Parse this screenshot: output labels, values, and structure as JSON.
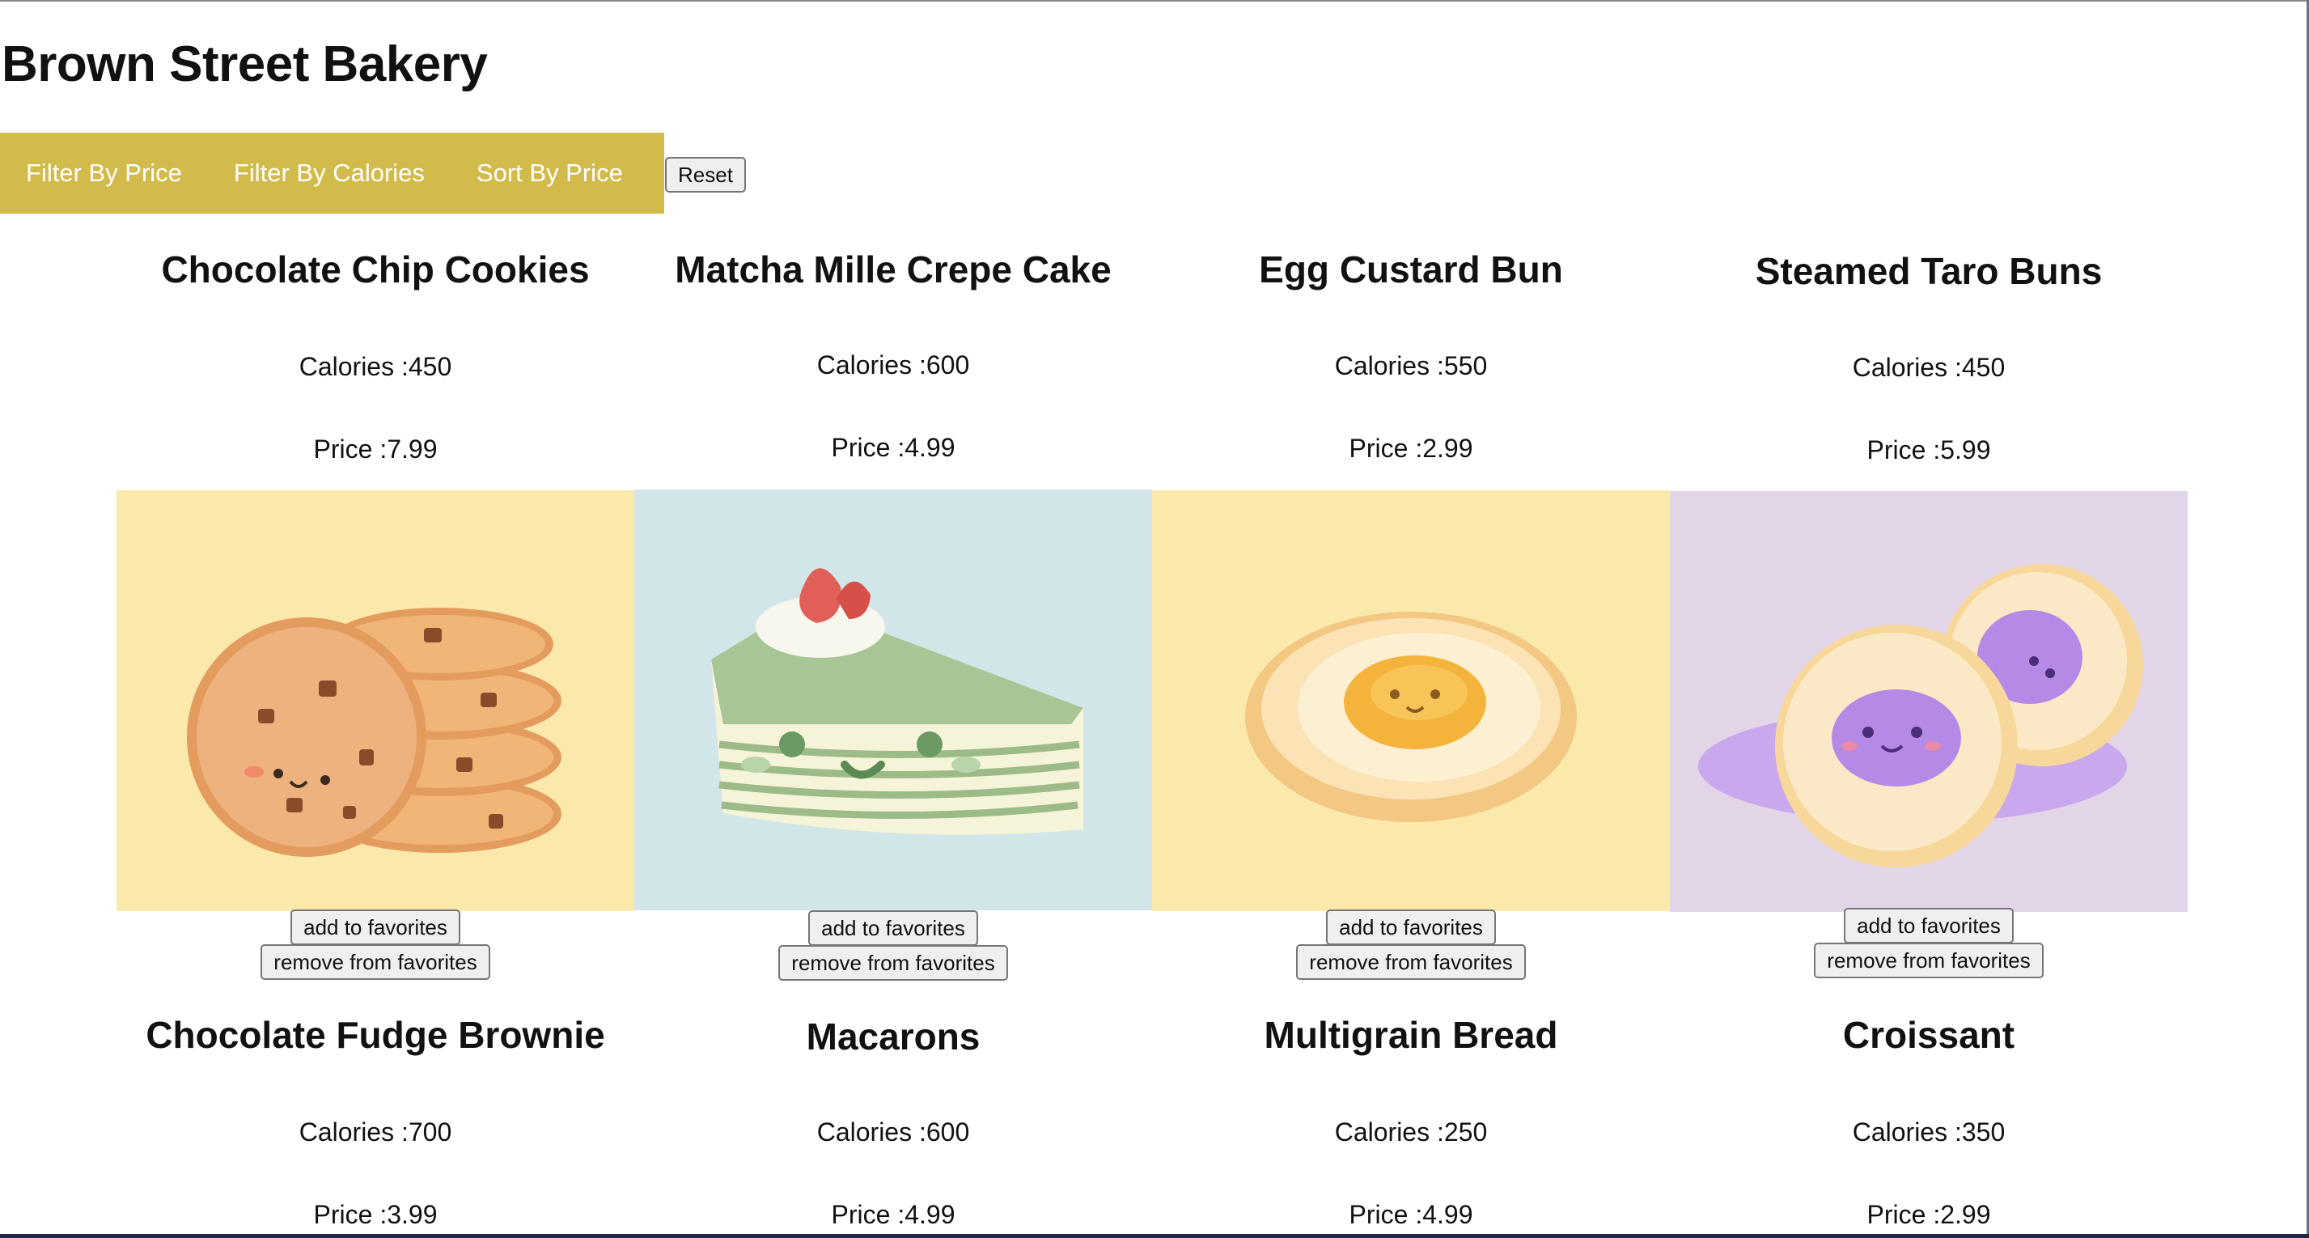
{
  "page": {
    "title": "Brown Street Bakery"
  },
  "nav": {
    "filter_price": "Filter By Price",
    "filter_calories": "Filter By Calories",
    "sort_price": "Sort By Price",
    "reset": "Reset"
  },
  "items": [
    {
      "name": "Chocolate Chip Cookies",
      "calories": "Calories :450",
      "price": "Price :7.99",
      "add": "add to favorites",
      "remove": "remove from favorites",
      "image": "cookies-illustration",
      "bg": "#fbe9ab"
    },
    {
      "name": "Matcha Mille Crepe Cake",
      "calories": "Calories :600",
      "price": "Price :4.99",
      "add": "add to favorites",
      "remove": "remove from favorites",
      "image": "crepe-cake-illustration",
      "bg": "#d2e6e9"
    },
    {
      "name": "Egg Custard Bun",
      "calories": "Calories :550",
      "price": "Price :2.99",
      "add": "add to favorites",
      "remove": "remove from favorites",
      "image": "custard-bun-illustration",
      "bg": "#fbe9ab"
    },
    {
      "name": "Steamed Taro Buns",
      "calories": "Calories :450",
      "price": "Price :5.99",
      "add": "add to favorites",
      "remove": "remove from favorites",
      "image": "taro-buns-illustration",
      "bg": "#e2d5e7"
    },
    {
      "name": "Chocolate Fudge Brownie",
      "calories": "Calories :700",
      "price": "Price :3.99"
    },
    {
      "name": "Macarons",
      "calories": "Calories :600",
      "price": "Price :4.99"
    },
    {
      "name": "Multigrain Bread",
      "calories": "Calories :250",
      "price": "Price :4.99"
    },
    {
      "name": "Croissant",
      "calories": "Calories :350",
      "price": "Price :2.99"
    }
  ]
}
